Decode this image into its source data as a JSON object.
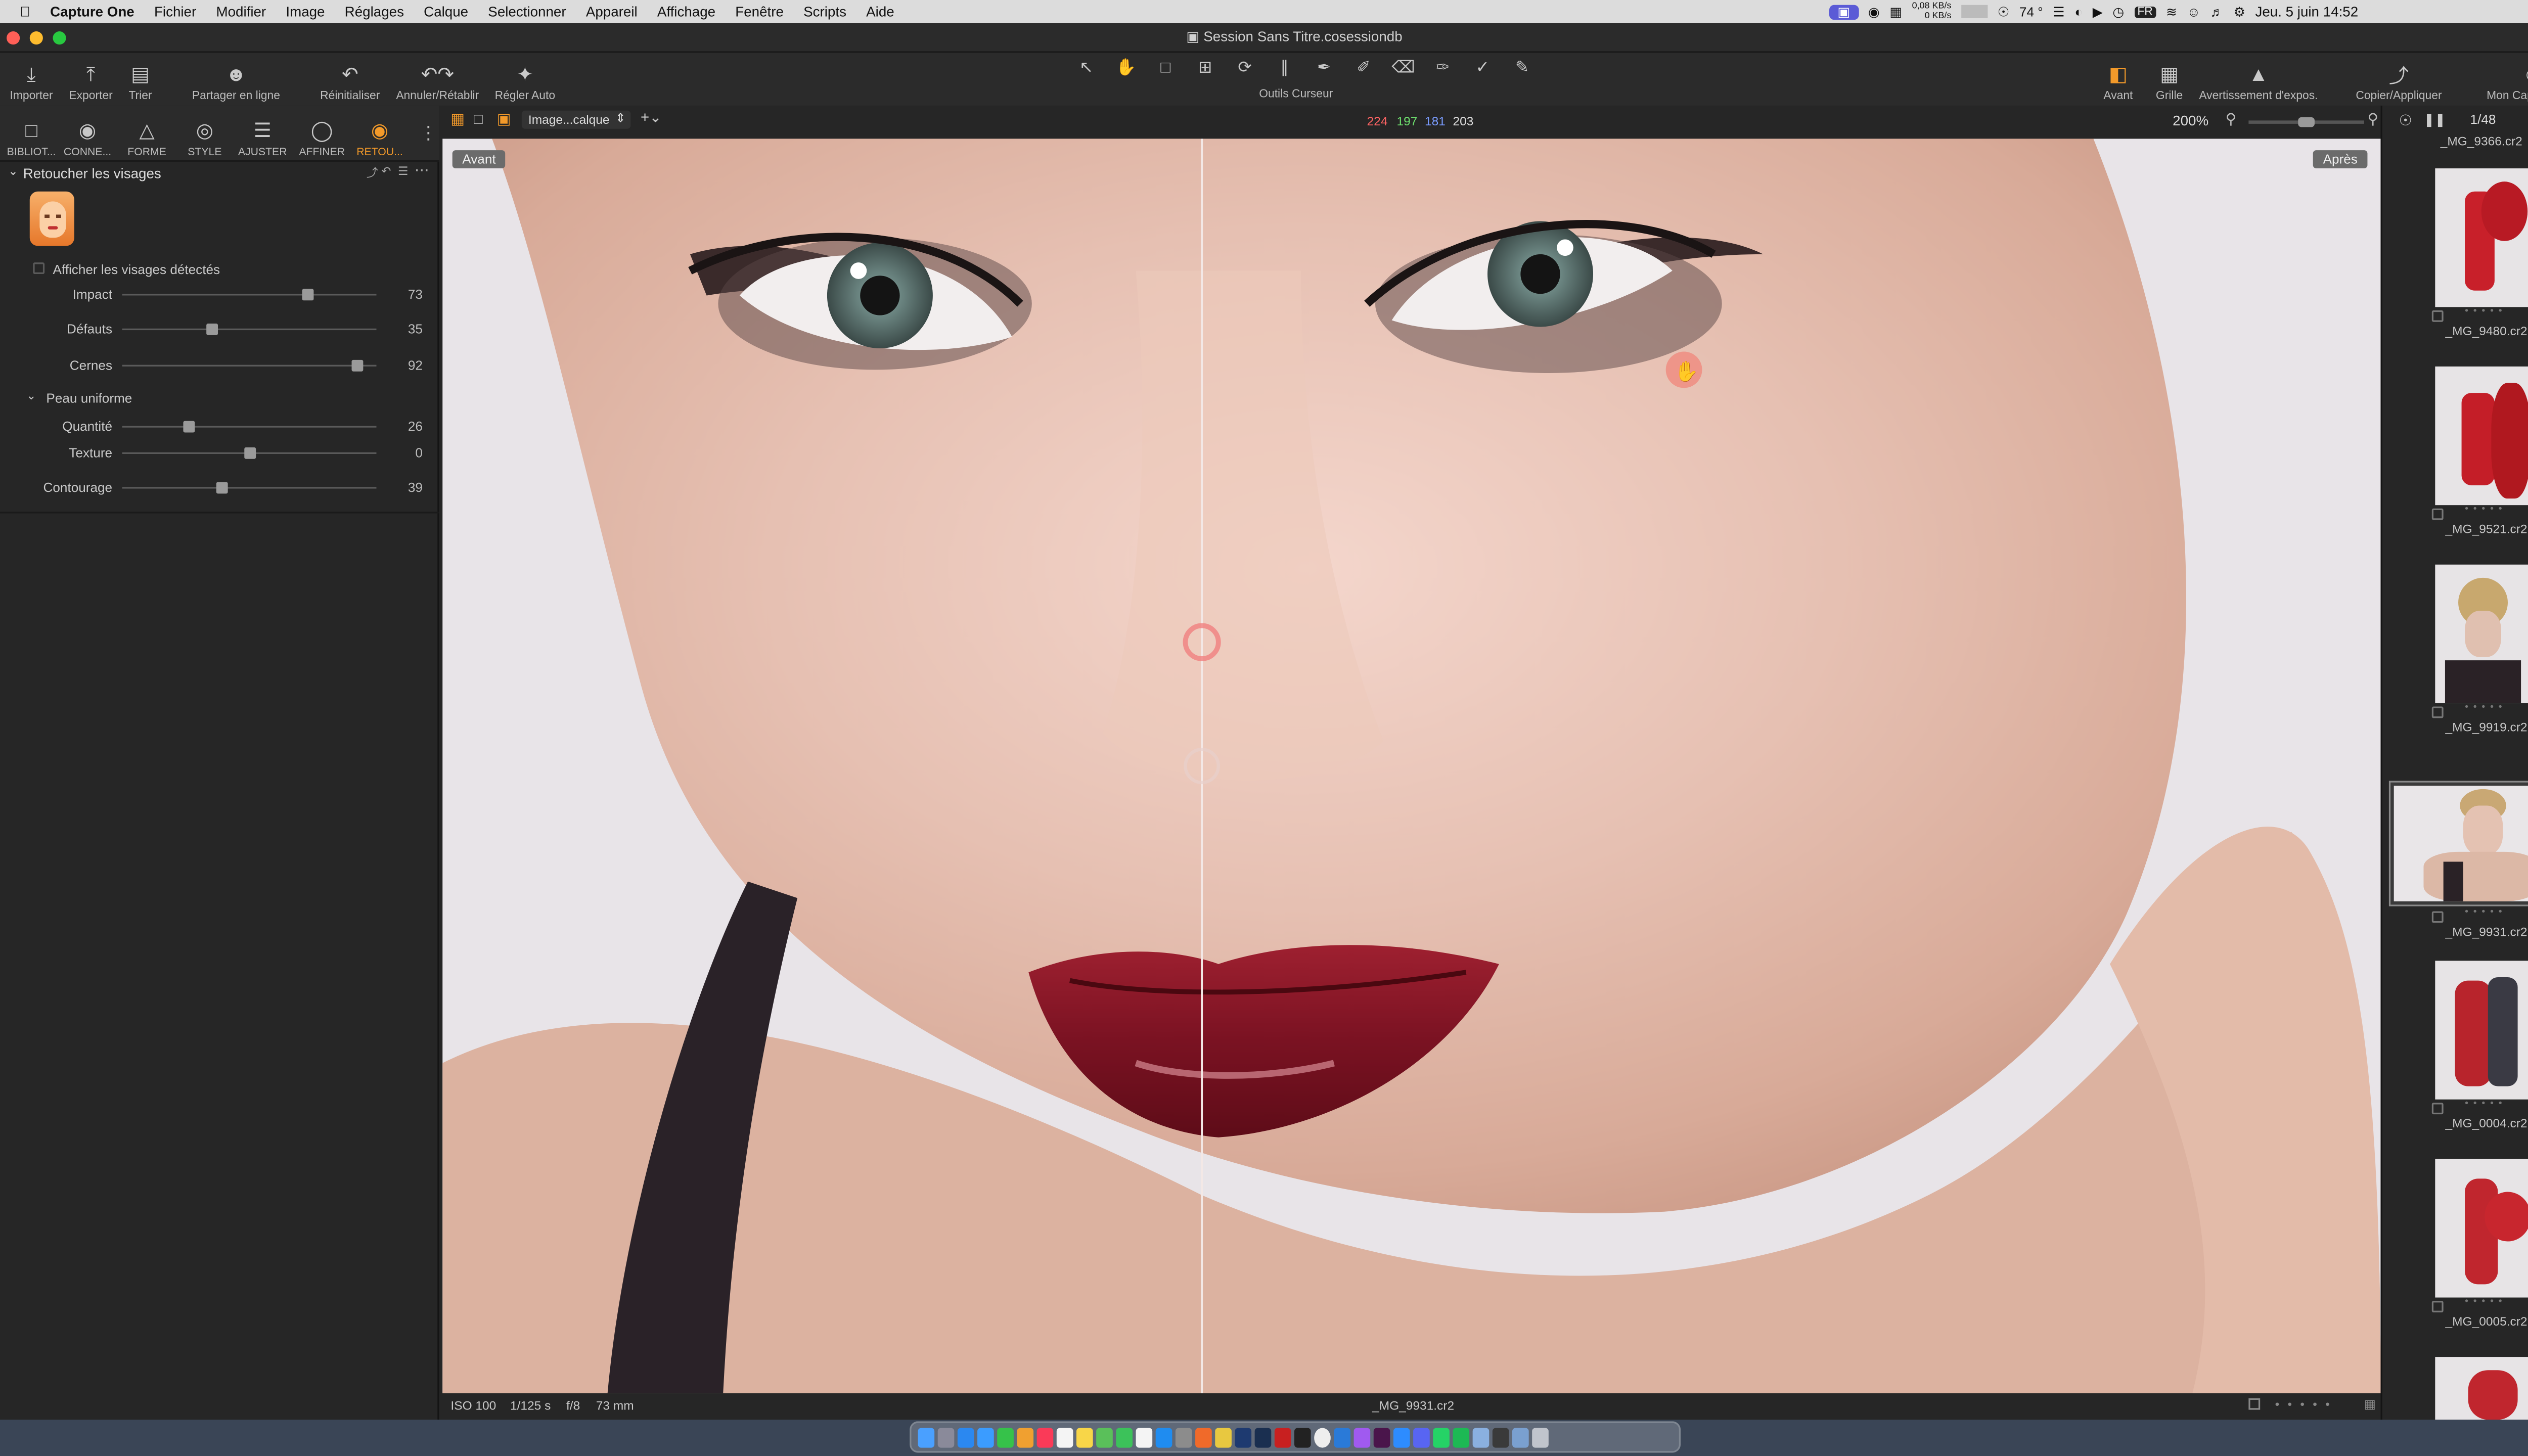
{
  "menubar": {
    "apple": "",
    "app_name": "Capture One",
    "items": [
      "Fichier",
      "Modifier",
      "Image",
      "Réglages",
      "Calque",
      "Selectionner",
      "Appareil",
      "Affichage",
      "Fenêtre",
      "Scripts",
      "Aide"
    ],
    "net_up": "0,08 KB/s",
    "net_down": "0 KB/s",
    "temp": "74 °",
    "lang": "FR",
    "datetime": "Jeu. 5 juin  14:52"
  },
  "window": {
    "title": "Session Sans Titre.cosessiondb"
  },
  "toolbar": {
    "left": [
      {
        "label": "Importer",
        "icon": "import-icon"
      },
      {
        "label": "Exporter",
        "icon": "export-icon"
      },
      {
        "label": "Trier",
        "icon": "sort-icon"
      },
      {
        "label": "Partager en ligne",
        "icon": "share-icon"
      },
      {
        "label": "Réinitialiser",
        "icon": "reset-icon"
      },
      {
        "label": "Annuler/Rétablir",
        "icon": "undo-redo-icon"
      },
      {
        "label": "Régler Auto",
        "icon": "auto-adjust-icon"
      }
    ],
    "center_label": "Outils Curseur",
    "right": [
      {
        "label": "Avant",
        "icon": "before-icon"
      },
      {
        "label": "Grille",
        "icon": "grid-icon"
      },
      {
        "label": "Avertissement d'expos.",
        "icon": "exposure-warning-icon"
      },
      {
        "label": "Copier/Appliquer",
        "icon": "copy-apply-icon"
      },
      {
        "label": "Mon Capture One",
        "icon": "account-icon"
      }
    ]
  },
  "tabs": [
    {
      "label": "BIBLIOT...",
      "icon": "library-icon"
    },
    {
      "label": "CONNE...",
      "icon": "capture-icon"
    },
    {
      "label": "FORME",
      "icon": "lens-icon"
    },
    {
      "label": "STYLE",
      "icon": "color-icon"
    },
    {
      "label": "AJUSTER",
      "icon": "adjust-icon"
    },
    {
      "label": "AFFINER",
      "icon": "details-icon"
    },
    {
      "label": "RETOU...",
      "icon": "retouch-icon"
    }
  ],
  "panel": {
    "title": "Retoucher les visages",
    "show_faces": "Afficher les visages détectés",
    "sliders": [
      {
        "label": "Impact",
        "value": "73",
        "pos": 73
      },
      {
        "label": "Défauts",
        "value": "35",
        "pos": 35
      },
      {
        "label": "Cernes",
        "value": "92",
        "pos": 92
      }
    ],
    "section": "Peau uniforme",
    "skin_sliders": [
      {
        "label": "Quantité",
        "value": "26",
        "pos": 26
      },
      {
        "label": "Texture",
        "value": "0",
        "pos": 50
      },
      {
        "label": "Contourage",
        "value": "39",
        "pos": 39
      }
    ]
  },
  "viewerbar": {
    "layer": "Image...calque",
    "rgb_r": "224",
    "rgb_g": "197",
    "rgb_b": "181",
    "rgb_l": "203",
    "zoom": "200%",
    "counter": "1/48"
  },
  "viewer": {
    "before_label": "Avant",
    "after_label": "Après"
  },
  "status": {
    "iso": "ISO 100",
    "shutter": "1/125 s",
    "aperture": "f/8",
    "focal": "73 mm",
    "filename": "_MG_9931.cr2"
  },
  "browser": {
    "top_name": "_MG_9366.cr2",
    "thumbs": [
      {
        "name": "_MG_9480.cr2",
        "color": "#c8202a",
        "selected": false
      },
      {
        "name": "_MG_9521.cr2",
        "color": "#c41e28",
        "selected": false
      },
      {
        "name": "_MG_9919.cr2",
        "color": "#b49a7a",
        "selected": false
      },
      {
        "name": "_MG_9931.cr2",
        "color": "#c8a88a",
        "selected": true
      },
      {
        "name": "_MG_0004.cr2",
        "color": "#b8242c",
        "selected": false
      },
      {
        "name": "_MG_0005.cr2",
        "color": "#c0262e",
        "selected": false
      }
    ]
  },
  "colors": {
    "accent": "#f39a2a",
    "panel_bg": "#262626",
    "toolbar_bg": "#2b2b2b"
  }
}
